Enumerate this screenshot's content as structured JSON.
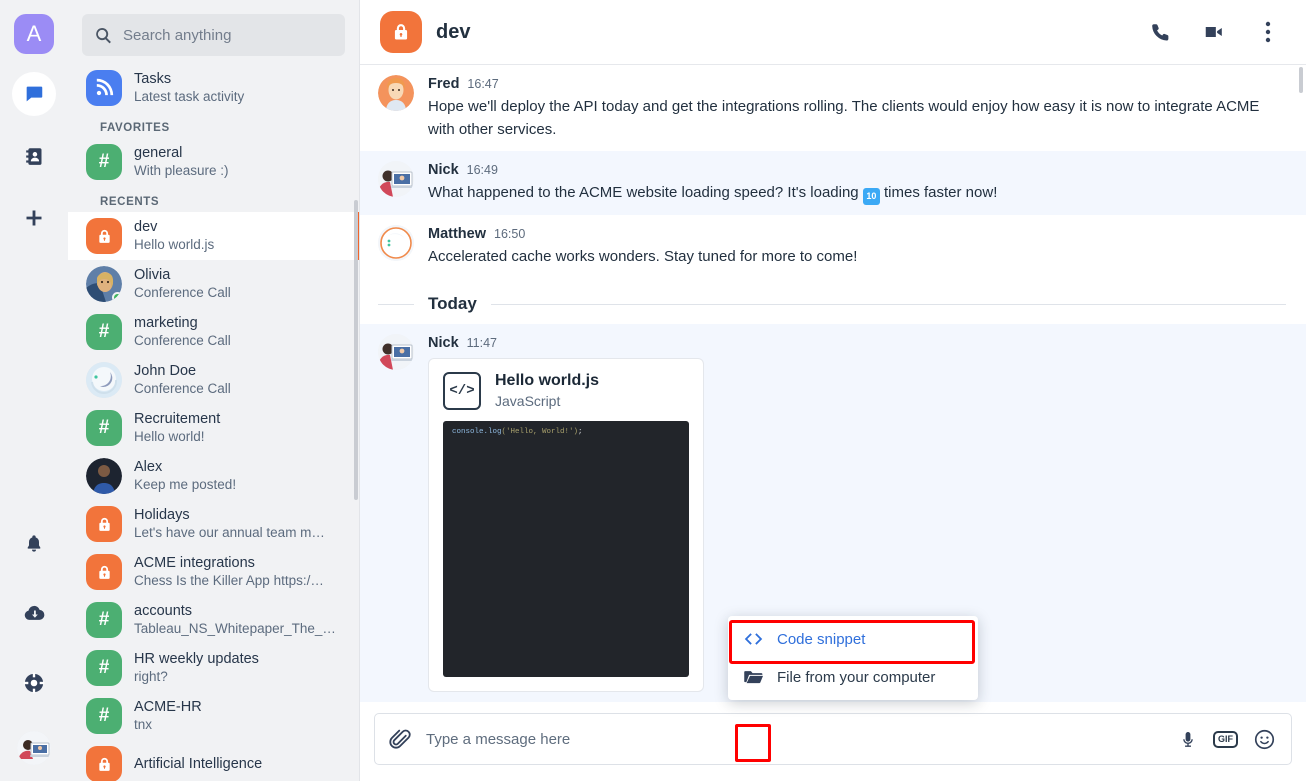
{
  "app": {
    "logo_letter": "A",
    "rail_icons": [
      {
        "name": "chat-icon",
        "label": "Chats"
      },
      {
        "name": "contacts-icon",
        "label": "Contacts"
      },
      {
        "name": "add-icon",
        "label": "Add"
      }
    ],
    "rail_bottom_icons": [
      {
        "name": "bell-icon",
        "label": "Notifications"
      },
      {
        "name": "cloud-download-icon",
        "label": "Downloads"
      },
      {
        "name": "life-ring-icon",
        "label": "Help"
      }
    ]
  },
  "search": {
    "placeholder": "Search anything",
    "value": "",
    "icon": "search-icon"
  },
  "sidebar": {
    "pinned": {
      "title": "Tasks",
      "subtitle": "Latest task activity",
      "avatar_type": "rss"
    },
    "sections": [
      {
        "label": "FAVORITES",
        "items": [
          {
            "title": "general",
            "subtitle": "With pleasure :)",
            "avatar_type": "hash",
            "active": false,
            "online": false
          }
        ]
      },
      {
        "label": "RECENTS",
        "items": [
          {
            "title": "dev",
            "subtitle": "Hello world.js",
            "avatar_type": "lock",
            "active": true,
            "online": false
          },
          {
            "title": "Olivia",
            "subtitle": "Conference Call",
            "avatar_type": "photo-olivia",
            "active": false,
            "online": true
          },
          {
            "title": "marketing",
            "subtitle": "Conference Call",
            "avatar_type": "hash",
            "active": false,
            "online": false
          },
          {
            "title": "John Doe",
            "subtitle": "Conference Call",
            "avatar_type": "photo-astronaut",
            "active": false,
            "online": false
          },
          {
            "title": "Recruitement",
            "subtitle": "Hello world!",
            "avatar_type": "hash",
            "active": false,
            "online": false
          },
          {
            "title": "Alex",
            "subtitle": "Keep me posted!",
            "avatar_type": "photo-alex",
            "active": false,
            "online": false
          },
          {
            "title": "Holidays",
            "subtitle": "Let's have our annual team m…",
            "avatar_type": "lock",
            "active": false,
            "online": false
          },
          {
            "title": "ACME integrations",
            "subtitle": "Chess Is the Killer App https:/…",
            "avatar_type": "lock",
            "active": false,
            "online": false
          },
          {
            "title": "accounts",
            "subtitle": "Tableau_NS_Whitepaper_The_…",
            "avatar_type": "hash",
            "active": false,
            "online": false
          },
          {
            "title": "HR weekly updates",
            "subtitle": "right?",
            "avatar_type": "hash",
            "active": false,
            "online": false
          },
          {
            "title": "ACME-HR",
            "subtitle": "tnx",
            "avatar_type": "hash",
            "active": false,
            "online": false
          },
          {
            "title": "Artificial Intelligence",
            "subtitle": "",
            "avatar_type": "lock",
            "active": false,
            "online": false
          }
        ]
      }
    ]
  },
  "chat": {
    "title": "dev",
    "avatar_type": "lock",
    "header_actions": [
      {
        "name": "phone-call-icon",
        "label": "Call"
      },
      {
        "name": "video-call-icon",
        "label": "Video call"
      },
      {
        "name": "more-options-icon",
        "label": "More"
      }
    ],
    "messages": [
      {
        "author": "Fred",
        "time": "16:47",
        "text": "Hope we'll deploy the API today and get the integrations rolling. The clients would enjoy how easy it is now to integrate ACME with other services.",
        "highlight": false,
        "avatar_type": "photo-fred"
      },
      {
        "author": "Nick",
        "time": "16:49",
        "text_before": "What happened to the ACME website loading speed? It's loading ",
        "emoji": "10",
        "text_after": " times faster now!",
        "highlight": true,
        "avatar_type": "photo-nick"
      },
      {
        "author": "Matthew",
        "time": "16:50",
        "text": "Accelerated cache works wonders. Stay tuned for more to come!",
        "highlight": false,
        "avatar_type": "photo-matthew"
      }
    ],
    "date_divider": "Today",
    "snippet_message": {
      "author": "Nick",
      "time": "11:47",
      "avatar_type": "photo-nick",
      "file_name": "Hello world.js",
      "language": "JavaScript",
      "code_prefix": "console.log",
      "code_string": "('Hello, World!')",
      "code_suffix": ";",
      "icon": "code-icon"
    }
  },
  "attach_menu": {
    "items": [
      {
        "label": "Code snippet",
        "icon": "code-brackets-icon",
        "highlighted": true
      },
      {
        "label": "File from your computer",
        "icon": "folder-icon",
        "highlighted": false
      }
    ]
  },
  "composer": {
    "placeholder": "Type a message here",
    "value": "",
    "attach_icon": "paperclip-icon",
    "actions": [
      {
        "name": "microphone-icon",
        "label": "Voice message"
      },
      {
        "name": "gif-icon",
        "label": "GIF"
      },
      {
        "name": "emoji-icon",
        "label": "Emoji"
      }
    ],
    "gif_label": "GIF"
  },
  "colors": {
    "accent_orange": "#f2642a",
    "brand_purple": "#9b8cf5",
    "hash_green": "#4caf72",
    "link_blue": "#2f6fdb",
    "highlight_red": "#ff0000",
    "msg_highlight_bg": "#f3f7fe"
  }
}
